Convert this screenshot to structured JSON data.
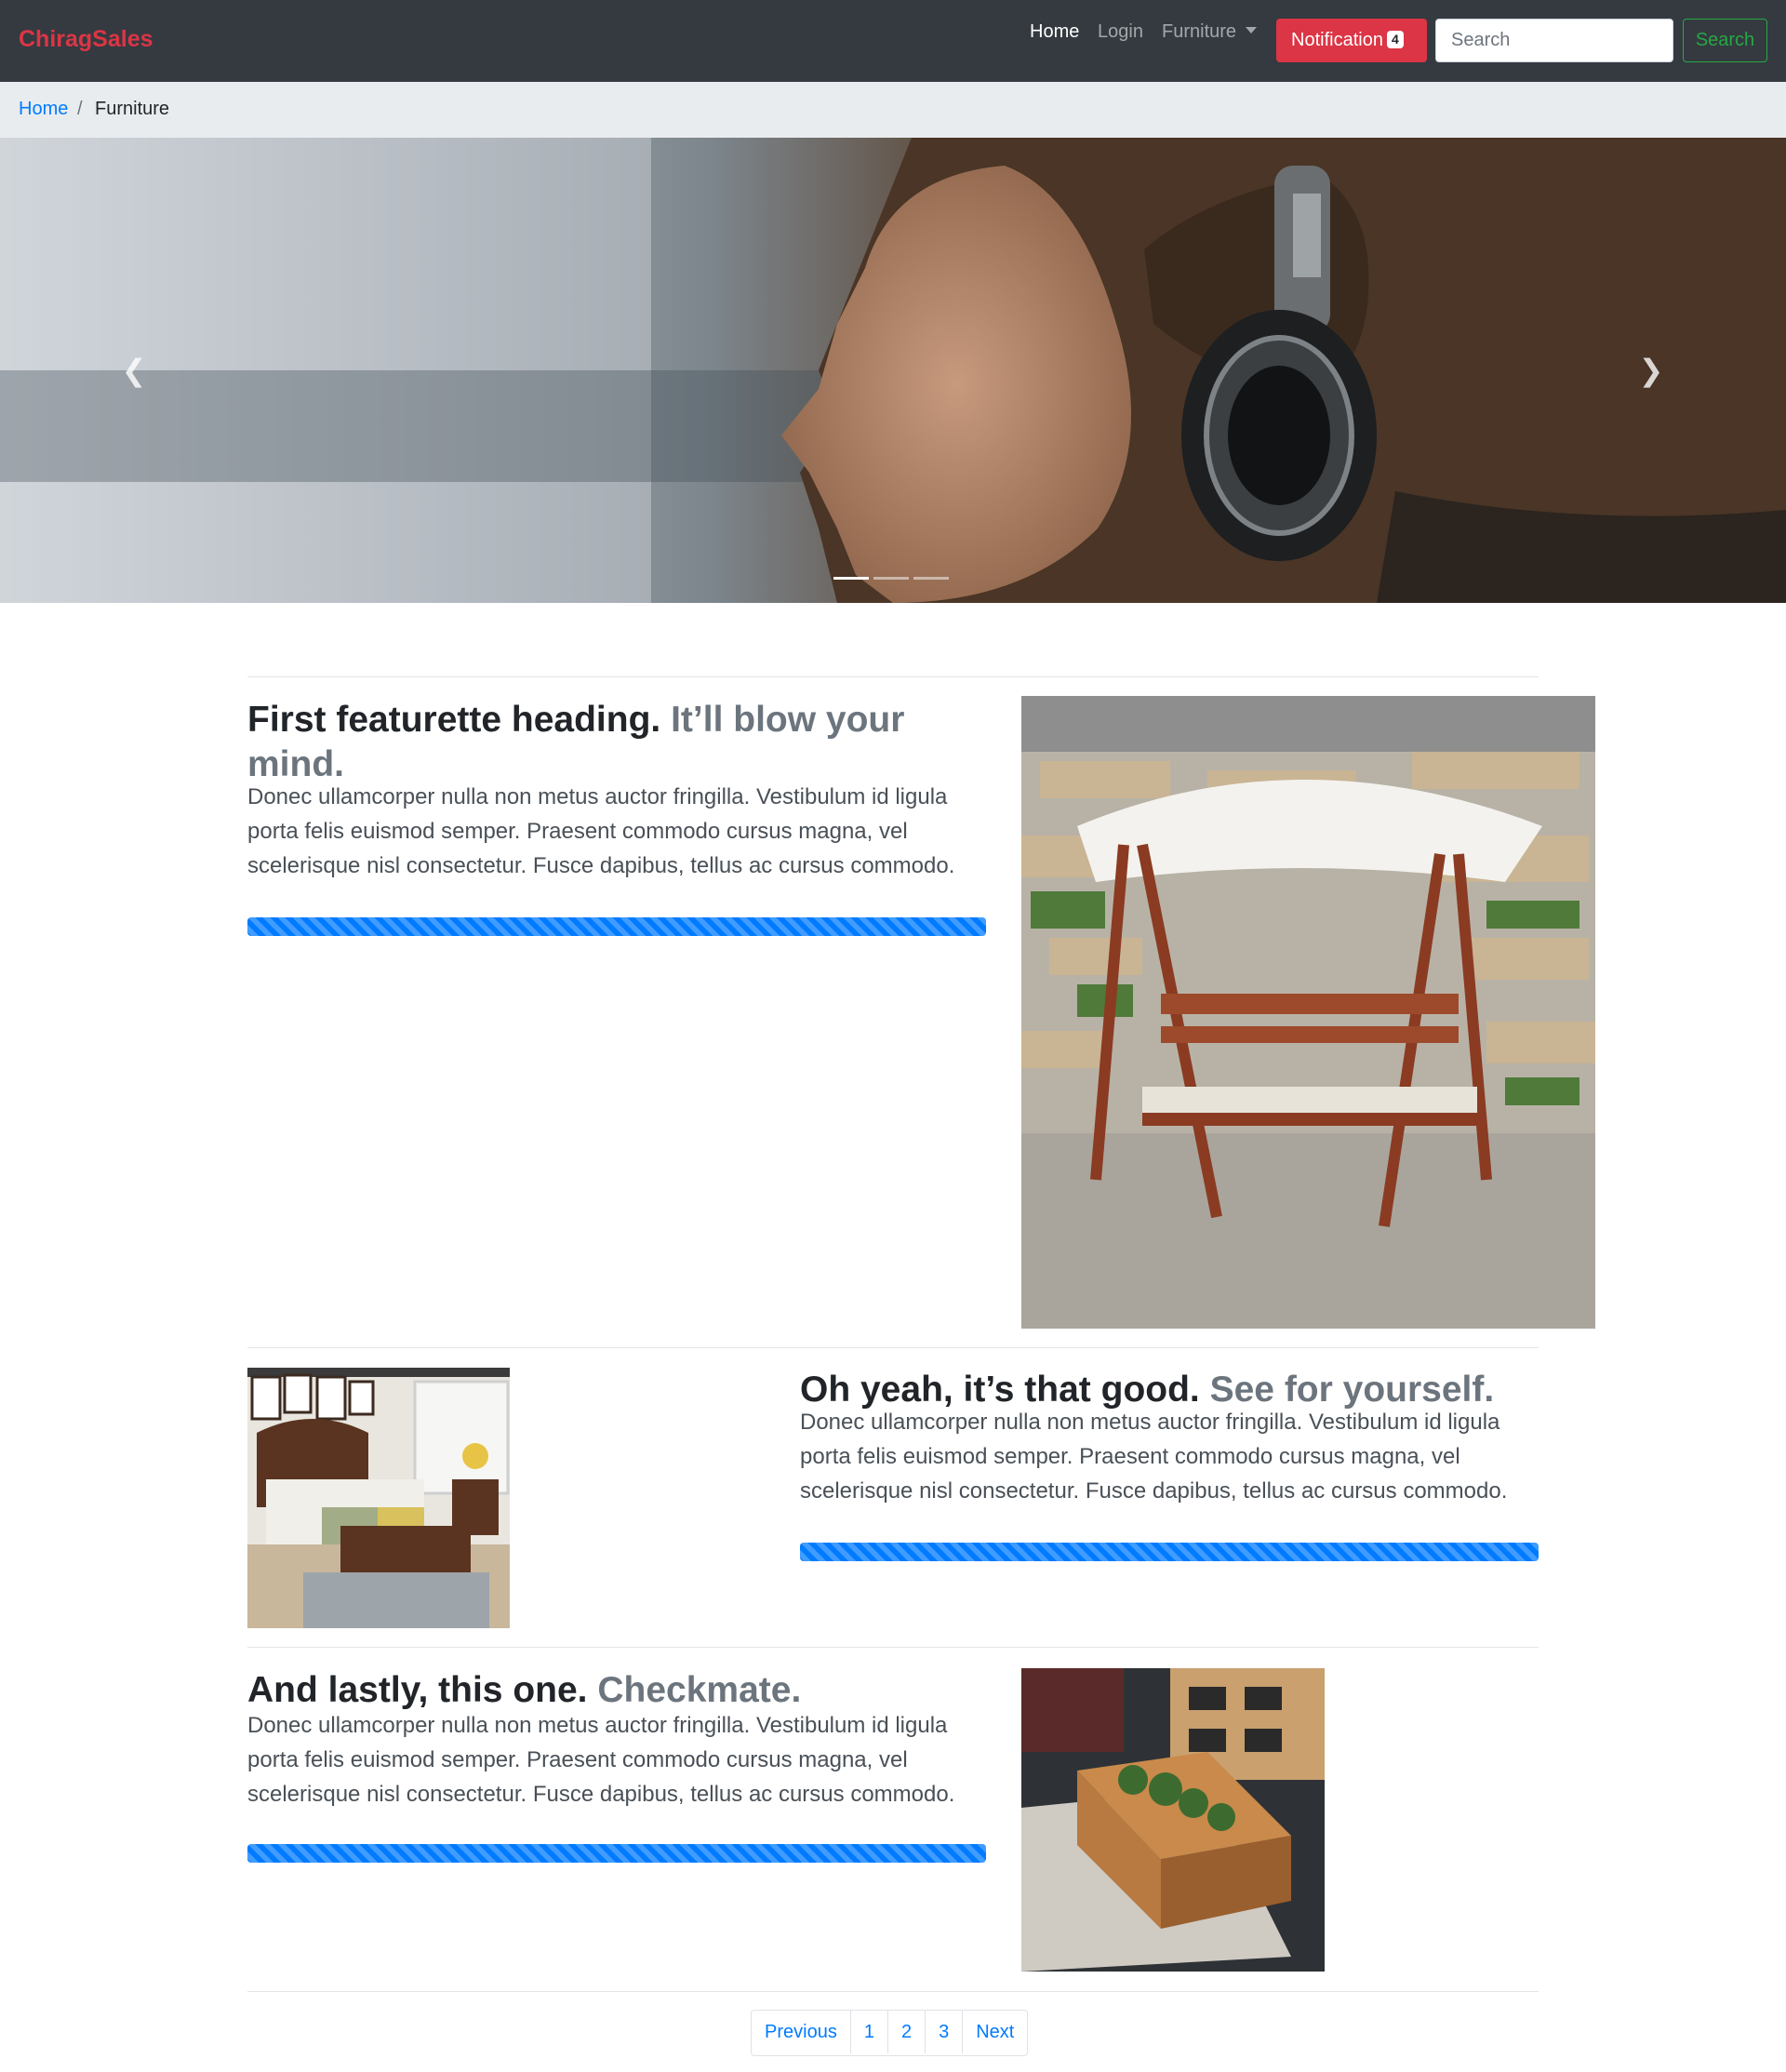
{
  "navbar": {
    "brand": "ChiragSales",
    "links": [
      {
        "label": "Home",
        "active": true
      },
      {
        "label": "Login",
        "active": false
      },
      {
        "label": "Furniture",
        "active": false,
        "dropdown": true
      }
    ],
    "notification": {
      "label": "Notification",
      "count": "4"
    },
    "search": {
      "placeholder": "Search",
      "value": "",
      "button_label": "Search"
    }
  },
  "breadcrumb": {
    "home": "Home",
    "separator": "/",
    "current": "Furniture"
  },
  "carousel": {
    "prev_icon": "chevron-left-icon",
    "next_icon": "chevron-right-icon",
    "indicator_count": 3,
    "active_indicator": 0
  },
  "featurettes": [
    {
      "heading": "First featurette heading.",
      "heading_muted": "It’ll blow your mind.",
      "text": "Donec ullamcorper nulla non metus auctor fringilla. Vestibulum id ligula porta felis euismod semper. Praesent commodo cursus magna, vel scelerisque nisl consectetur. Fusce dapibus, tellus ac cursus commodo.",
      "progress": 1.0
    },
    {
      "heading": "Oh yeah, it’s that good.",
      "heading_muted": "See for yourself.",
      "text": "Donec ullamcorper nulla non metus auctor fringilla. Vestibulum id ligula porta felis euismod semper. Praesent commodo cursus magna, vel scelerisque nisl consectetur. Fusce dapibus, tellus ac cursus commodo.",
      "progress": 1.0
    },
    {
      "heading": "And lastly, this one.",
      "heading_muted": "Checkmate.",
      "text": "Donec ullamcorper nulla non metus auctor fringilla. Vestibulum id ligula porta felis euismod semper. Praesent commodo cursus magna, vel scelerisque nisl consectetur. Fusce dapibus, tellus ac cursus commodo.",
      "progress": 1.0
    }
  ],
  "pagination": {
    "previous": "Previous",
    "pages": [
      "1",
      "2",
      "3"
    ],
    "next": "Next"
  },
  "colors": {
    "brand": "#dc3545",
    "navbar": "#343a40",
    "primary": "#007bff",
    "success": "#28a745",
    "danger": "#dc3545"
  }
}
